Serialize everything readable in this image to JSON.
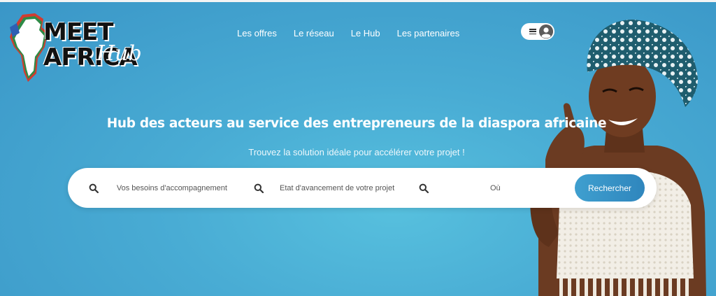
{
  "logo": {
    "meet": "MEET",
    "africa": "AFRICA",
    "hub": "Hub"
  },
  "nav": {
    "items": [
      {
        "label": "Les offres"
      },
      {
        "label": "Le réseau"
      },
      {
        "label": "Le Hub"
      },
      {
        "label": "Les partenaires"
      }
    ]
  },
  "user_menu": {
    "icons": [
      "menu-icon",
      "avatar-icon"
    ]
  },
  "hero": {
    "headline": "Hub des acteurs au service des entrepreneurs de la diaspora africaine",
    "subline": "Trouvez la solution idéale pour accélérer votre projet !"
  },
  "search": {
    "needs_placeholder": "Vos besoins d'accompagnement",
    "stage_placeholder": "Etat d'avancement de votre projet",
    "where_placeholder": "Où",
    "button_label": "Rechercher"
  },
  "colors": {
    "background": "#49acd4",
    "button": "#2f86bd",
    "text": "#ffffff"
  }
}
